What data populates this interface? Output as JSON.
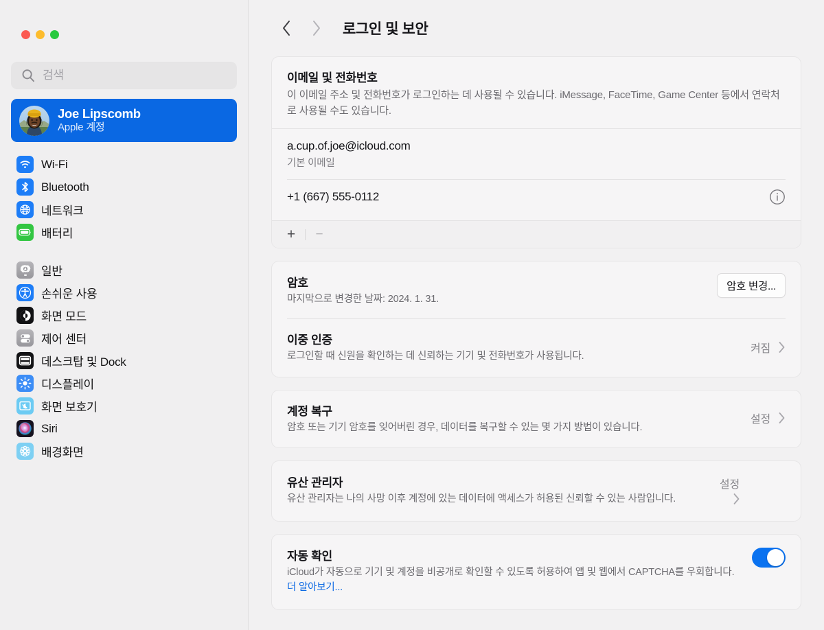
{
  "window": {
    "traffic_lights": {
      "close": "close-button",
      "minimize": "minimize-button",
      "zoom": "zoom-button"
    }
  },
  "sidebar": {
    "search": {
      "value": "",
      "placeholder": "검색"
    },
    "account": {
      "name": "Joe Lipscomb",
      "subtitle": "Apple 계정",
      "avatar_alt": "사용자 사진",
      "selected": true,
      "accent_color": "#0a68e3"
    },
    "groups": [
      {
        "items": [
          {
            "label": "Wi-Fi",
            "icon": "wifi-icon",
            "tile": "ic-wifi"
          },
          {
            "label": "Bluetooth",
            "icon": "bluetooth-icon",
            "tile": "ic-bluetooth"
          },
          {
            "label": "네트워크",
            "icon": "network-globe-icon",
            "tile": "ic-network"
          },
          {
            "label": "배터리",
            "icon": "battery-icon",
            "tile": "ic-battery"
          }
        ]
      },
      {
        "items": [
          {
            "label": "일반",
            "icon": "gear-icon",
            "tile": "ic-general"
          },
          {
            "label": "손쉬운 사용",
            "icon": "accessibility-icon",
            "tile": "ic-access"
          },
          {
            "label": "화면 모드",
            "icon": "appearance-icon",
            "tile": "ic-appear"
          },
          {
            "label": "제어 센터",
            "icon": "control-center-icon",
            "tile": "ic-control"
          },
          {
            "label": "데스크탑 및 Dock",
            "icon": "desktop-dock-icon",
            "tile": "ic-dock"
          },
          {
            "label": "디스플레이",
            "icon": "brightness-icon",
            "tile": "ic-display"
          },
          {
            "label": "화면 보호기",
            "icon": "screensaver-icon",
            "tile": "ic-screensaver"
          },
          {
            "label": "Siri",
            "icon": "siri-icon",
            "tile": "ic-siri"
          },
          {
            "label": "배경화면",
            "icon": "wallpaper-icon",
            "tile": "ic-wallpaper"
          }
        ]
      }
    ]
  },
  "toolbar": {
    "back_icon": "chevron-left-icon",
    "forward_icon": "chevron-right-icon",
    "title": "로그인 및 보안"
  },
  "sections": {
    "contact": {
      "title": "이메일 및 전화번호",
      "description": "이 이메일 주소 및 전화번호가 로그인하는 데 사용될 수 있습니다. iMessage, FaceTime, Game Center 등에서 연락처로 사용될 수도 있습니다.",
      "entries": [
        {
          "value": "a.cup.of.joe@icloud.com",
          "sub": "기본 이메일",
          "has_info": false
        },
        {
          "value": "+1 (667) 555-0112",
          "sub": "",
          "has_info": true
        }
      ],
      "add_label": "+",
      "remove_label": "−"
    },
    "password": {
      "title": "암호",
      "subtitle": "마지막으로 변경한 날짜: 2024. 1. 31.",
      "button_label": "암호 변경..."
    },
    "two_factor": {
      "title": "이중 인증",
      "subtitle": "로그인할 때 신원을 확인하는 데 신뢰하는 기기 및 전화번호가 사용됩니다.",
      "value": "켜짐"
    },
    "account_recovery": {
      "title": "계정 복구",
      "subtitle": "암호 또는 기기 암호를 잊어버린 경우, 데이터를 복구할 수 있는 몇 가지 방법이 있습니다.",
      "value": "설정"
    },
    "legacy_contact": {
      "title": "유산 관리자",
      "subtitle": "유산 관리자는 나의 사망 이후 계정에 있는 데이터에 액세스가 허용된 신뢰할 수 있는 사람입니다.",
      "value": "설정"
    },
    "automatic_verification": {
      "title": "자동 확인",
      "subtitle": "iCloud가 자동으로 기기 및 계정을 비공개로 확인할 수 있도록 허용하여 앱 및 웹에서 CAPTCHA를 우회합니다. ",
      "link_label": "더 알아보기...",
      "toggle_on": true
    }
  }
}
